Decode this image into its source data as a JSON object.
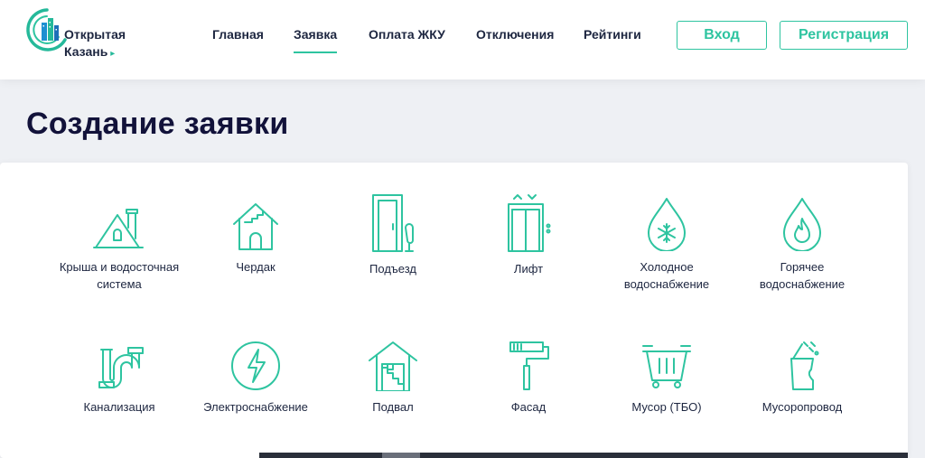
{
  "logo": {
    "line1": "Открытая",
    "line2": "Казань",
    "arrow": "▸"
  },
  "nav": {
    "items": [
      {
        "label": "Главная"
      },
      {
        "label": "Заявка"
      },
      {
        "label": "Оплата ЖКУ"
      },
      {
        "label": "Отключения"
      },
      {
        "label": "Рейтинги"
      }
    ],
    "active_index": 1
  },
  "auth": {
    "login_label": "Вход",
    "register_label": "Регистрация"
  },
  "page": {
    "title": "Создание заявки"
  },
  "categories": [
    {
      "icon": "roof-icon",
      "label_line1": "Крыша и водосточная",
      "label_line2": "система"
    },
    {
      "icon": "attic-icon",
      "label_line1": "Чердак",
      "label_line2": ""
    },
    {
      "icon": "entrance-door-icon",
      "label_line1": "Подъезд",
      "label_line2": ""
    },
    {
      "icon": "elevator-icon",
      "label_line1": "Лифт",
      "label_line2": ""
    },
    {
      "icon": "cold-water-icon",
      "label_line1": "Холодное",
      "label_line2": "водоснабжение"
    },
    {
      "icon": "hot-water-icon",
      "label_line1": "Горячее",
      "label_line2": "водоснабжение"
    },
    {
      "icon": "sewerage-pipe-icon",
      "label_line1": "Канализация",
      "label_line2": ""
    },
    {
      "icon": "lightning-icon",
      "label_line1": "Электроснабжение",
      "label_line2": ""
    },
    {
      "icon": "basement-icon",
      "label_line1": "Подвал",
      "label_line2": ""
    },
    {
      "icon": "paint-roller-icon",
      "label_line1": "Фасад",
      "label_line2": ""
    },
    {
      "icon": "trash-container-icon",
      "label_line1": "Мусор (ТБО)",
      "label_line2": ""
    },
    {
      "icon": "garbage-chute-icon",
      "label_line1": "Мусоропровод",
      "label_line2": ""
    }
  ],
  "colors": {
    "accent": "#2ec4a0",
    "title": "#12123a",
    "text": "#1d2640",
    "background": "#eef0f4"
  }
}
